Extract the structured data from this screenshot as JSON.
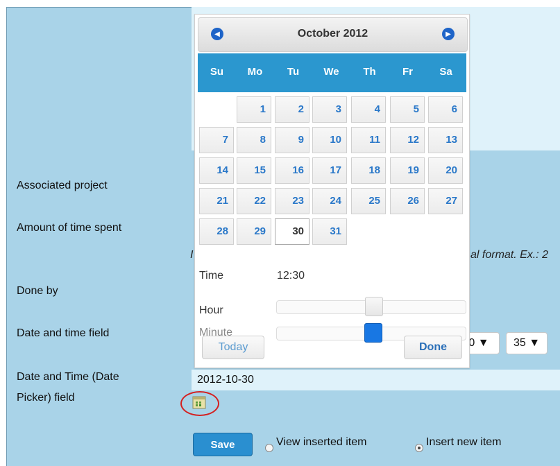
{
  "form": {
    "labels": {
      "associated_project": "Associated project",
      "amount_time": "Amount of time spent",
      "done_by": "Done by",
      "date_time_field": "Date and time field",
      "dt_picker_line1": "Date and Time (Date",
      "dt_picker_line2": "Picker) field"
    },
    "amount_hint": "al format. Ex.: 2",
    "hour_select": "0 ▼",
    "minute_select": "35 ▼",
    "date_value": "2012-10-30",
    "save_label": "Save",
    "radio_view": "View inserted item",
    "radio_insert": "Insert new item",
    "selected_radio": "insert"
  },
  "datepicker": {
    "month_title": "October 2012",
    "weekdays": [
      "Su",
      "Mo",
      "Tu",
      "We",
      "Th",
      "Fr",
      "Sa"
    ],
    "weeks": [
      [
        "",
        "1",
        "2",
        "3",
        "4",
        "5",
        "6"
      ],
      [
        "7",
        "8",
        "9",
        "10",
        "11",
        "12",
        "13"
      ],
      [
        "14",
        "15",
        "16",
        "17",
        "18",
        "19",
        "20"
      ],
      [
        "21",
        "22",
        "23",
        "24",
        "25",
        "26",
        "27"
      ],
      [
        "28",
        "29",
        "30",
        "31",
        "",
        "",
        ""
      ]
    ],
    "selected_day": "30",
    "time_label": "Time",
    "time_value": "12:30",
    "hour_label": "Hour",
    "minute_label": "Minute",
    "hour_fraction": 0.52,
    "minute_fraction": 0.5,
    "today_label": "Today",
    "done_label": "Done"
  },
  "colors": {
    "panel": "#a9d3e8",
    "header": "#2b97cf",
    "day_text": "#2a78c9",
    "save": "#2a8fd0",
    "handle_active": "#1877e3"
  },
  "icons": {
    "prev": "prev-month-icon",
    "next": "next-month-icon",
    "calendar": "calendar-icon"
  }
}
